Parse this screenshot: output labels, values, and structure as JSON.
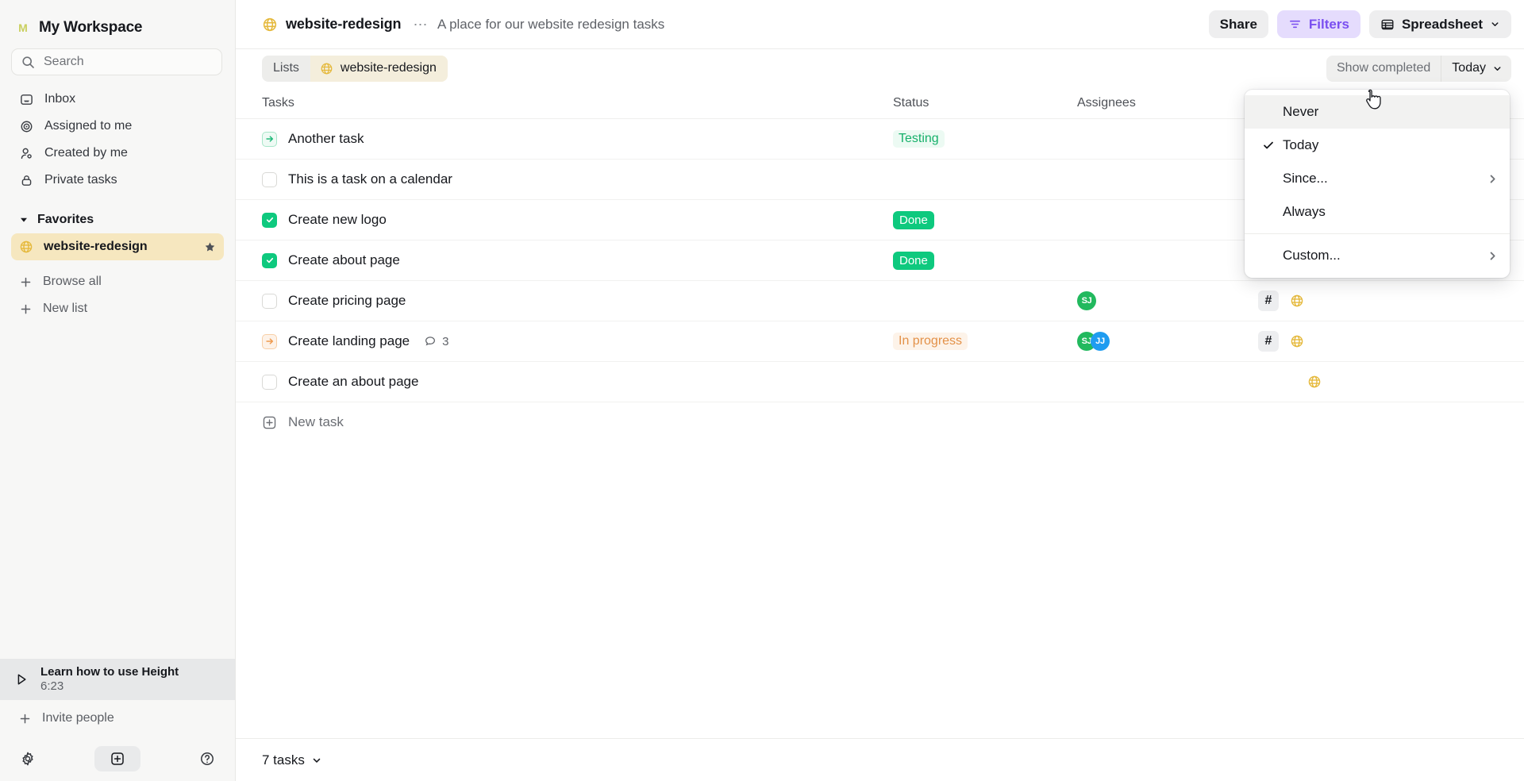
{
  "sidebar": {
    "workspace": {
      "initial": "M",
      "name": "My Workspace"
    },
    "search": {
      "placeholder": "Search",
      "icon": "search-icon"
    },
    "nav_items": [
      {
        "label": "Inbox",
        "icon": "inbox-icon"
      },
      {
        "label": "Assigned to me",
        "icon": "target-icon"
      },
      {
        "label": "Created by me",
        "icon": "person-icon"
      },
      {
        "label": "Private tasks",
        "icon": "lock-icon"
      }
    ],
    "favorites": {
      "label": "Favorites",
      "icon": "caret-down-icon"
    },
    "favorite_items": [
      {
        "label": "website-redesign",
        "icon": "globe-icon",
        "star": "star-icon",
        "active": true
      }
    ],
    "actions": [
      {
        "label": "Browse all",
        "icon": "plus-icon"
      },
      {
        "label": "New list",
        "icon": "plus-icon"
      }
    ],
    "learn_card": {
      "title": "Learn how to use Height",
      "duration": "6:23",
      "icon": "play-icon"
    },
    "invite": {
      "label": "Invite people",
      "icon": "plus-icon"
    },
    "footer": [
      {
        "name": "settings-icon"
      },
      {
        "name": "new-item-icon"
      },
      {
        "name": "help-icon"
      }
    ]
  },
  "topbar": {
    "doc_icon": "globe-icon",
    "title": "website-redesign",
    "more": "⋯",
    "subtitle": "A place for our website redesign tasks",
    "share_label": "Share",
    "filters_label": "Filters",
    "view_label": "Spreadsheet"
  },
  "subbar": {
    "breadcrumb_root": "Lists",
    "breadcrumb_current": "website-redesign",
    "show_completed_label": "Show completed",
    "completed_value": "Today"
  },
  "table": {
    "columns": [
      "Tasks",
      "Status",
      "Assignees"
    ],
    "rows": [
      {
        "title": "Another task",
        "marker": "arrow-green",
        "status": "Testing",
        "status_style": "testing",
        "assignees": [],
        "extras": [],
        "comments": null
      },
      {
        "title": "This is a task on a calendar",
        "marker": "checkbox-empty",
        "status": "",
        "status_style": "",
        "assignees": [],
        "extras": [],
        "comments": null
      },
      {
        "title": "Create new logo",
        "marker": "checkbox-done",
        "status": "Done",
        "status_style": "done",
        "assignees": [],
        "extras": [],
        "comments": null
      },
      {
        "title": "Create about page",
        "marker": "checkbox-done",
        "status": "Done",
        "status_style": "done",
        "assignees": [],
        "extras": [
          "globe"
        ],
        "comments": null
      },
      {
        "title": "Create pricing page",
        "marker": "checkbox-empty",
        "status": "",
        "status_style": "",
        "assignees": [
          {
            "initials": "SJ",
            "color": "#22b95e"
          }
        ],
        "extras": [
          "hash",
          "globe"
        ],
        "comments": null
      },
      {
        "title": "Create landing page",
        "marker": "arrow-orange",
        "status": "In progress",
        "status_style": "inprogress",
        "assignees": [
          {
            "initials": "SJ",
            "color": "#22b95e"
          },
          {
            "initials": "JJ",
            "color": "#1f9cf0"
          }
        ],
        "extras": [
          "hash",
          "globe"
        ],
        "comments": "3"
      },
      {
        "title": "Create an about page",
        "marker": "checkbox-empty",
        "status": "",
        "status_style": "",
        "assignees": [],
        "extras": [
          "globe"
        ],
        "comments": null
      }
    ],
    "new_task_label": "New task"
  },
  "bottombar": {
    "count_label": "7 tasks"
  },
  "menu": {
    "items": [
      {
        "label": "Never",
        "checked": false,
        "submenu": false,
        "hover": true
      },
      {
        "label": "Today",
        "checked": true,
        "submenu": false,
        "hover": false
      },
      {
        "label": "Since...",
        "checked": false,
        "submenu": true,
        "hover": false
      },
      {
        "label": "Always",
        "checked": false,
        "submenu": false,
        "hover": false
      }
    ],
    "footer_items": [
      {
        "label": "Custom...",
        "checked": false,
        "submenu": true,
        "hover": false
      }
    ]
  },
  "colors": {
    "accent_purple": "#7a4ff0",
    "green": "#0ec97e",
    "orange": "#e39148",
    "favorite_bg": "#f6e7bf"
  }
}
